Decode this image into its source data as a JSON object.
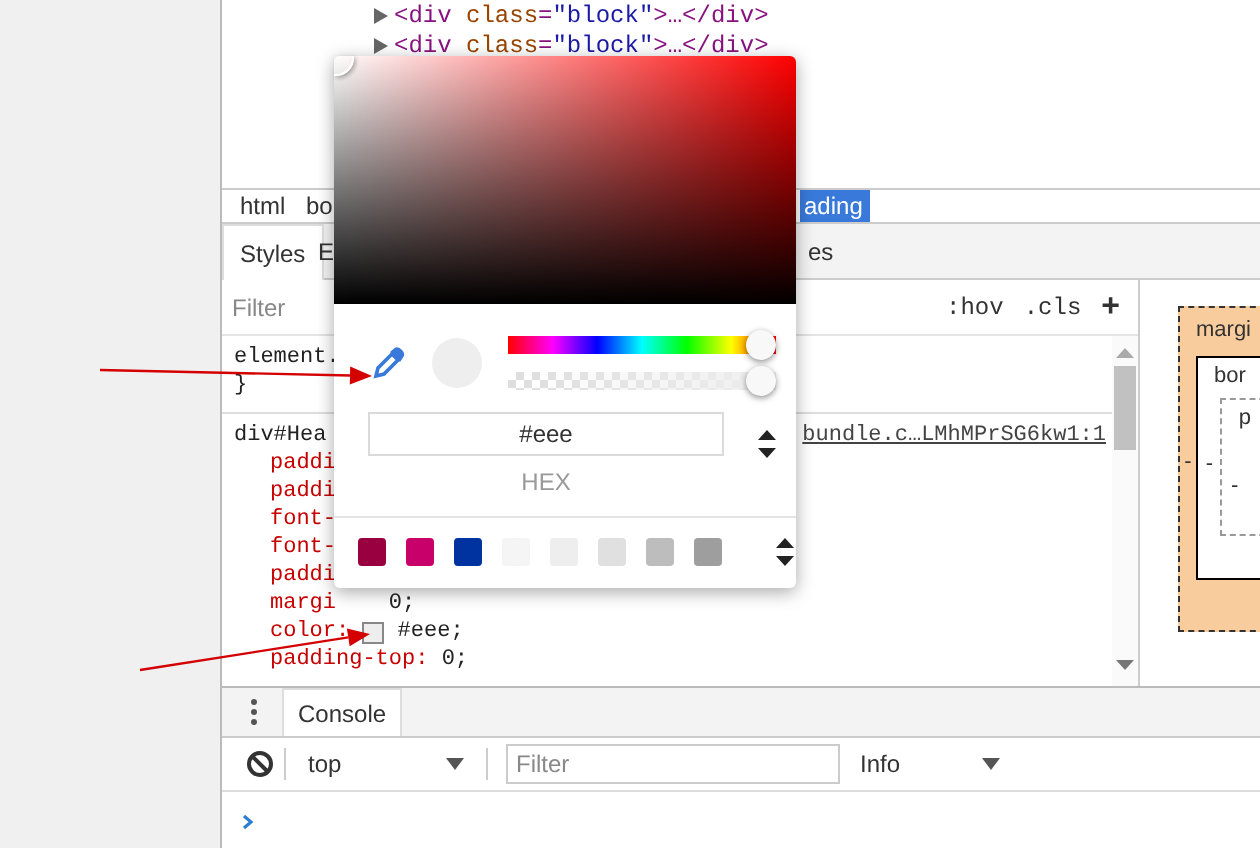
{
  "elements_tree": {
    "lines": [
      {
        "expanded": false,
        "segments": [
          {
            "kind": "tag",
            "text": "<div"
          },
          {
            "kind": "attr",
            "text": " class"
          },
          {
            "kind": "tag",
            "text": "="
          },
          {
            "kind": "value",
            "text": "\"block\""
          },
          {
            "kind": "tag",
            "text": ">…</div>"
          }
        ]
      },
      {
        "expanded": false,
        "segments": [
          {
            "kind": "tag",
            "text": "<div"
          },
          {
            "kind": "attr",
            "text": " class"
          },
          {
            "kind": "tag",
            "text": "="
          },
          {
            "kind": "value",
            "text": "\"block\""
          },
          {
            "kind": "tag",
            "text": ">…</div>"
          }
        ]
      }
    ]
  },
  "breadcrumbs": [
    {
      "label": "html",
      "selected": false
    },
    {
      "label": "bo",
      "selected": false
    },
    {
      "label": "ading",
      "selected": true
    }
  ],
  "sidebar_tabs": [
    {
      "label": "Styles",
      "selected": true
    },
    {
      "label": "E",
      "selected": false
    },
    {
      "label": "es",
      "selected": false
    }
  ],
  "styles_pane": {
    "filter": {
      "placeholder": "Filter"
    },
    "buttons": [
      ":hov",
      ".cls",
      "+"
    ],
    "rules": [
      {
        "selector": "element.",
        "closing": "}"
      },
      {
        "selector": "div#Hea",
        "source": "bundle.c…LMhMPrSG6kw1:1",
        "properties": [
          {
            "name": "paddi"
          },
          {
            "name": "paddi"
          },
          {
            "name": "font-"
          },
          {
            "name": "font-"
          },
          {
            "name": "paddi"
          },
          {
            "name": "margi",
            "value": "0;"
          },
          {
            "name": "color:",
            "color": "#eeeeee",
            "value": "#eee;"
          },
          {
            "name": "padding-top:",
            "value": "0;"
          }
        ]
      }
    ]
  },
  "box_model": {
    "margin_label": "margi",
    "border_label": "bor",
    "padding_label": "p",
    "left_values": [
      "-",
      "-",
      "-"
    ]
  },
  "color_picker": {
    "color": "#eeeeee",
    "hue": {
      "level": 1
    },
    "alpha": {
      "level": 1
    },
    "hex": {
      "value": "#eee"
    },
    "format_label": "HEX",
    "palette": [
      {
        "color": "#990040"
      },
      {
        "color": "#c8006a"
      },
      {
        "color": "#0033a0"
      },
      {
        "color": "#f5f5f5"
      },
      {
        "color": "#eeeeee"
      },
      {
        "color": "#e0e0e0"
      },
      {
        "color": "#bdbdbd"
      },
      {
        "color": "#9e9e9e"
      }
    ]
  },
  "console_drawer": {
    "tabs": [
      {
        "label": "Console",
        "selected": true
      }
    ],
    "context": "top",
    "filter": {
      "placeholder": "Filter"
    },
    "level": "Info"
  }
}
